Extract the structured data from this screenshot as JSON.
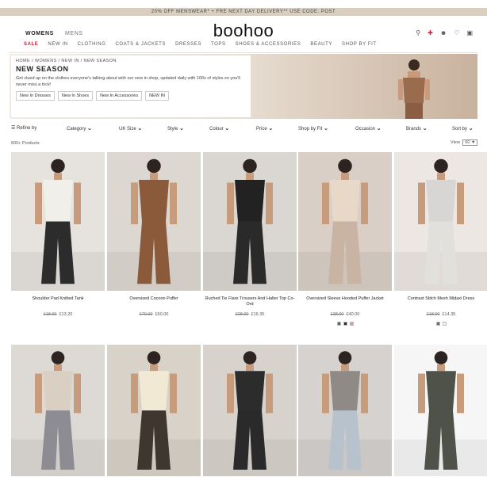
{
  "promo_bar": {
    "text": "20% OFF MENSWEAR* + FRE NEXT DAY DELIVERY** USE CODE: POST"
  },
  "header": {
    "gender_tabs": [
      "WOMENS",
      "MENS"
    ],
    "logo": "boohoo",
    "icons": [
      "search-icon",
      "flag-icon",
      "user-icon",
      "heart-icon",
      "bag-icon"
    ]
  },
  "category_nav": [
    "SALE",
    "NEW IN",
    "CLOTHING",
    "COATS & JACKETS",
    "DRESSES",
    "TOPS",
    "SHOES & ACCESSORIES",
    "BEAUTY",
    "SHOP BY FIT"
  ],
  "hero": {
    "breadcrumb": "HOME / WOMENS / NEW IN / NEW SEASON",
    "title": "NEW SEASON",
    "description": "Get clued up on the clothes everyone's talking about with our new in shop, updated daily with 100s of styles so you'll never miss a trick!",
    "chips": [
      "New In Dresses",
      "New In Shoes",
      "New In Accessories",
      "NEW IN"
    ],
    "accent": "#c9b29e"
  },
  "filters": {
    "refine": "Refine by",
    "items": [
      "Category",
      "UK Size",
      "Style",
      "Colour",
      "Price",
      "Shop by Fit",
      "Occasion",
      "Brands",
      "Sort by"
    ],
    "count": "500+ Products",
    "view_label": "View",
    "view_value": "60"
  },
  "products": [
    {
      "name": "Shoulder Pad Knitted Tank",
      "old": "£18.00",
      "new": "£13.20",
      "bg": "#e6e2dd",
      "top": "#f1efea",
      "bottom": "#2c2c2c",
      "swatches": []
    },
    {
      "name": "Oversized Cocoon Puffer",
      "old": "£70.00",
      "new": "£60.00",
      "bg": "#ddd7d1",
      "top": "#8a5a3b",
      "bottom": "#8a5a3b",
      "swatches": []
    },
    {
      "name": "Ruched Tie Flare Trousers And Halter Top Co-Ord",
      "old": "£28.00",
      "new": "£16.35",
      "bg": "#dad6d1",
      "top": "#222222",
      "bottom": "#2a2a2a",
      "swatches": []
    },
    {
      "name": "Oversized Sleeve Hooded Puffer Jacket",
      "old": "£38.00",
      "new": "£40.00",
      "bg": "#d9cfc6",
      "top": "#e8d8c8",
      "bottom": "#c9b3a2",
      "swatches": [
        "#5e5e5e",
        "#2b2b2b",
        "#c8a2a0"
      ]
    },
    {
      "name": "Contrast Stitch Mesh Midaxi Dress",
      "old": "£18.00",
      "new": "£14.35",
      "bg": "#ece7e3",
      "top": "#d8d6d4",
      "bottom": "#e2e0dd",
      "swatches": [
        "#6a6a6a",
        "#f2f2f2"
      ]
    },
    {
      "name": "",
      "old": "",
      "new": "",
      "bg": "#ddd9d4",
      "top": "#d9d0c3",
      "bottom": "#8d8c93",
      "swatches": []
    },
    {
      "name": "",
      "old": "",
      "new": "",
      "bg": "#d9d2c9",
      "top": "#f1e9d4",
      "bottom": "#3e362f",
      "swatches": []
    },
    {
      "name": "",
      "old": "",
      "new": "",
      "bg": "#d7d2cc",
      "top": "#2c2c2c",
      "bottom": "#2a2a2a",
      "swatches": []
    },
    {
      "name": "",
      "old": "",
      "new": "",
      "bg": "#d6d2cf",
      "top": "#8f8a85",
      "bottom": "#b7c2cd",
      "swatches": []
    },
    {
      "name": "",
      "old": "",
      "new": "",
      "bg": "#f6f6f6",
      "top": "#4e5249",
      "bottom": "#4e5249",
      "swatches": []
    }
  ]
}
